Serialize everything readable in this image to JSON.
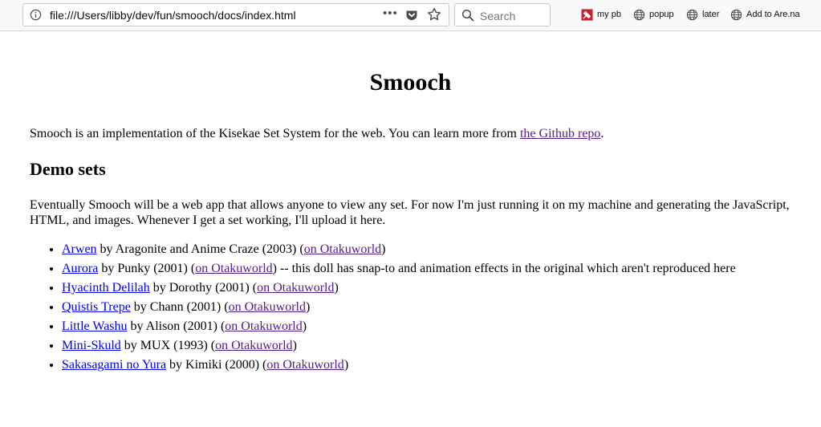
{
  "browser": {
    "url": "file:///Users/libby/dev/fun/smooch/docs/index.html",
    "overflow": "•••",
    "search_placeholder": "Search",
    "bookmarks": [
      {
        "label": "my pb",
        "icon": "pinboard-icon"
      },
      {
        "label": "popup",
        "icon": "globe-icon"
      },
      {
        "label": "later",
        "icon": "globe-icon"
      },
      {
        "label": "Add to Are.na",
        "icon": "globe-icon"
      }
    ]
  },
  "page": {
    "title": "Smooch",
    "intro_text": "Smooch is an implementation of the Kisekae Set System for the web. You can learn more from ",
    "intro_link": "the Github repo",
    "intro_end": ".",
    "section_title": "Demo sets",
    "section_text": "Eventually Smooch will be a web app that allows anyone to view any set. For now I'm just running it on my machine and generating the JavaScript, HTML, and images. Whenever I get a set working, I'll upload it here.",
    "sets": [
      {
        "name": "Arwen",
        "by": " by Aragonite and Anime Craze (2003) (",
        "source": "on Otakuworld",
        "after": ")"
      },
      {
        "name": "Aurora",
        "by": " by Punky (2001) (",
        "source": "on Otakuworld",
        "after": ") -- this doll has snap-to and animation effects in the original which aren't reproduced here"
      },
      {
        "name": "Hyacinth Delilah",
        "by": " by Dorothy (2001) (",
        "source": "on Otakuworld",
        "after": ")"
      },
      {
        "name": "Quistis Trepe",
        "by": " by Chann (2001) (",
        "source": "on Otakuworld",
        "after": ")"
      },
      {
        "name": "Little Washu",
        "by": " by Alison (2001) (",
        "source": "on Otakuworld",
        "after": ")"
      },
      {
        "name": "Mini-Skuld",
        "by": " by MUX (1993) (",
        "source": "on Otakuworld",
        "after": ")"
      },
      {
        "name": "Sakasagami no Yura",
        "by": " by Kimiki (2000) (",
        "source": "on Otakuworld",
        "after": ")"
      }
    ]
  }
}
